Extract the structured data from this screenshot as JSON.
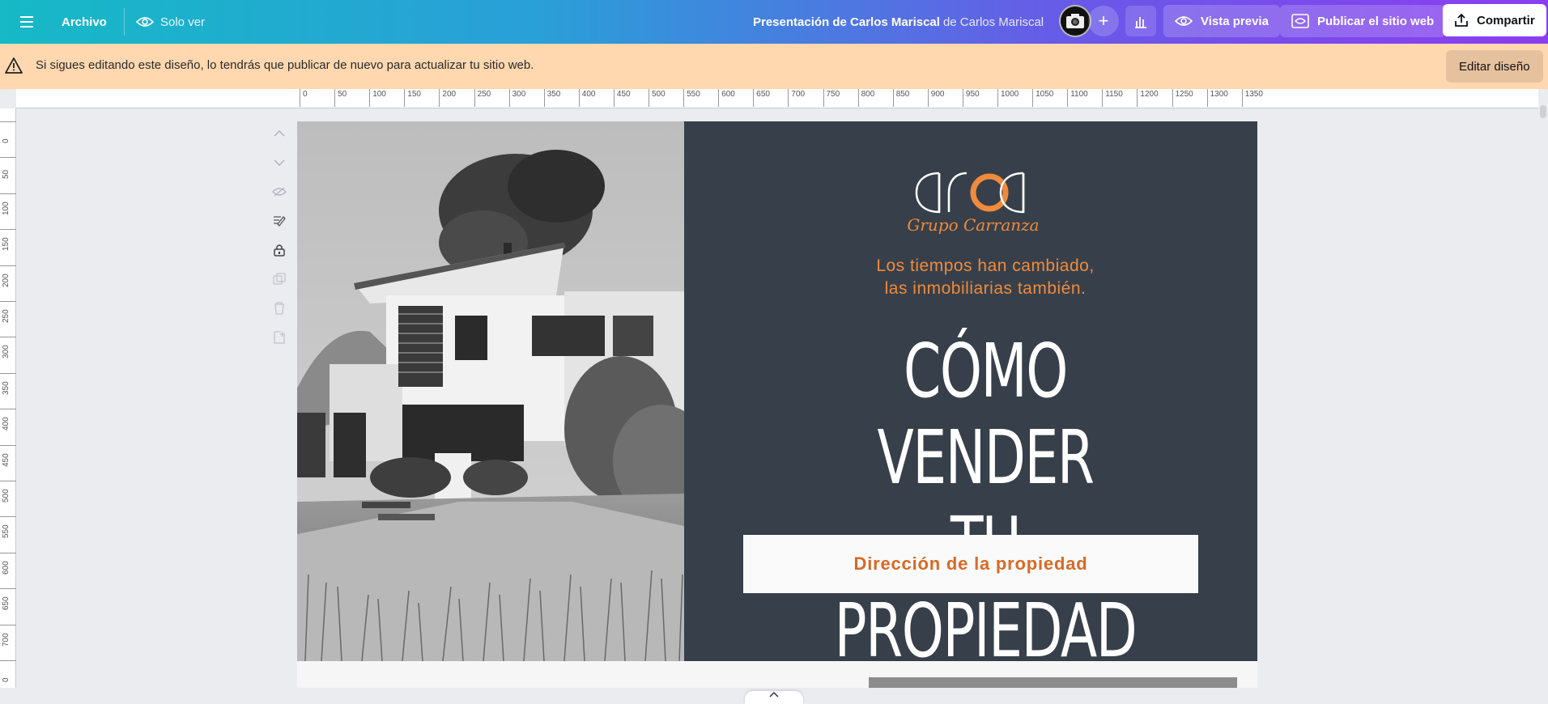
{
  "topbar": {
    "menu_icon": "hamburger-icon",
    "archivo_label": "Archivo",
    "view_mode_label": "Solo ver",
    "design_title": "Presentación de Carlos Mariscal",
    "design_owner": "de Carlos Mariscal",
    "add_label": "+",
    "preview_label": "Vista previa",
    "publish_label": "Publicar el sitio web",
    "share_label": "Compartir"
  },
  "warning": {
    "message": "Si sigues editando este diseño, lo tendrás que publicar de nuevo para actualizar tu sitio web.",
    "edit_label": "Editar diseño"
  },
  "ruler": {
    "h_ticks": [
      "0",
      "50",
      "100",
      "150",
      "200",
      "250",
      "300",
      "350",
      "400",
      "450",
      "500",
      "550",
      "600",
      "650",
      "700",
      "750",
      "800",
      "850",
      "900",
      "950",
      "1000",
      "1050",
      "1100",
      "1150",
      "1200",
      "1250",
      "1300",
      "1350"
    ],
    "v_ticks": [
      "0",
      "50",
      "100",
      "150",
      "200",
      "250",
      "300",
      "350",
      "400",
      "450",
      "500",
      "550",
      "600",
      "650",
      "700",
      "0"
    ]
  },
  "slide": {
    "logo_text": "arca",
    "logo_script": "Grupo Carranza",
    "tagline_line1": "Los tiempos han cambiado,",
    "tagline_line2": "las inmobiliarias también.",
    "headline_line1": "CÓMO VENDER",
    "headline_line2": "TU PROPIEDAD",
    "address_label": "Dirección de la propiedad"
  },
  "colors": {
    "slide_bg": "#37404a",
    "accent_orange": "#f08a3c",
    "warning_bg": "#ffd8b0"
  }
}
